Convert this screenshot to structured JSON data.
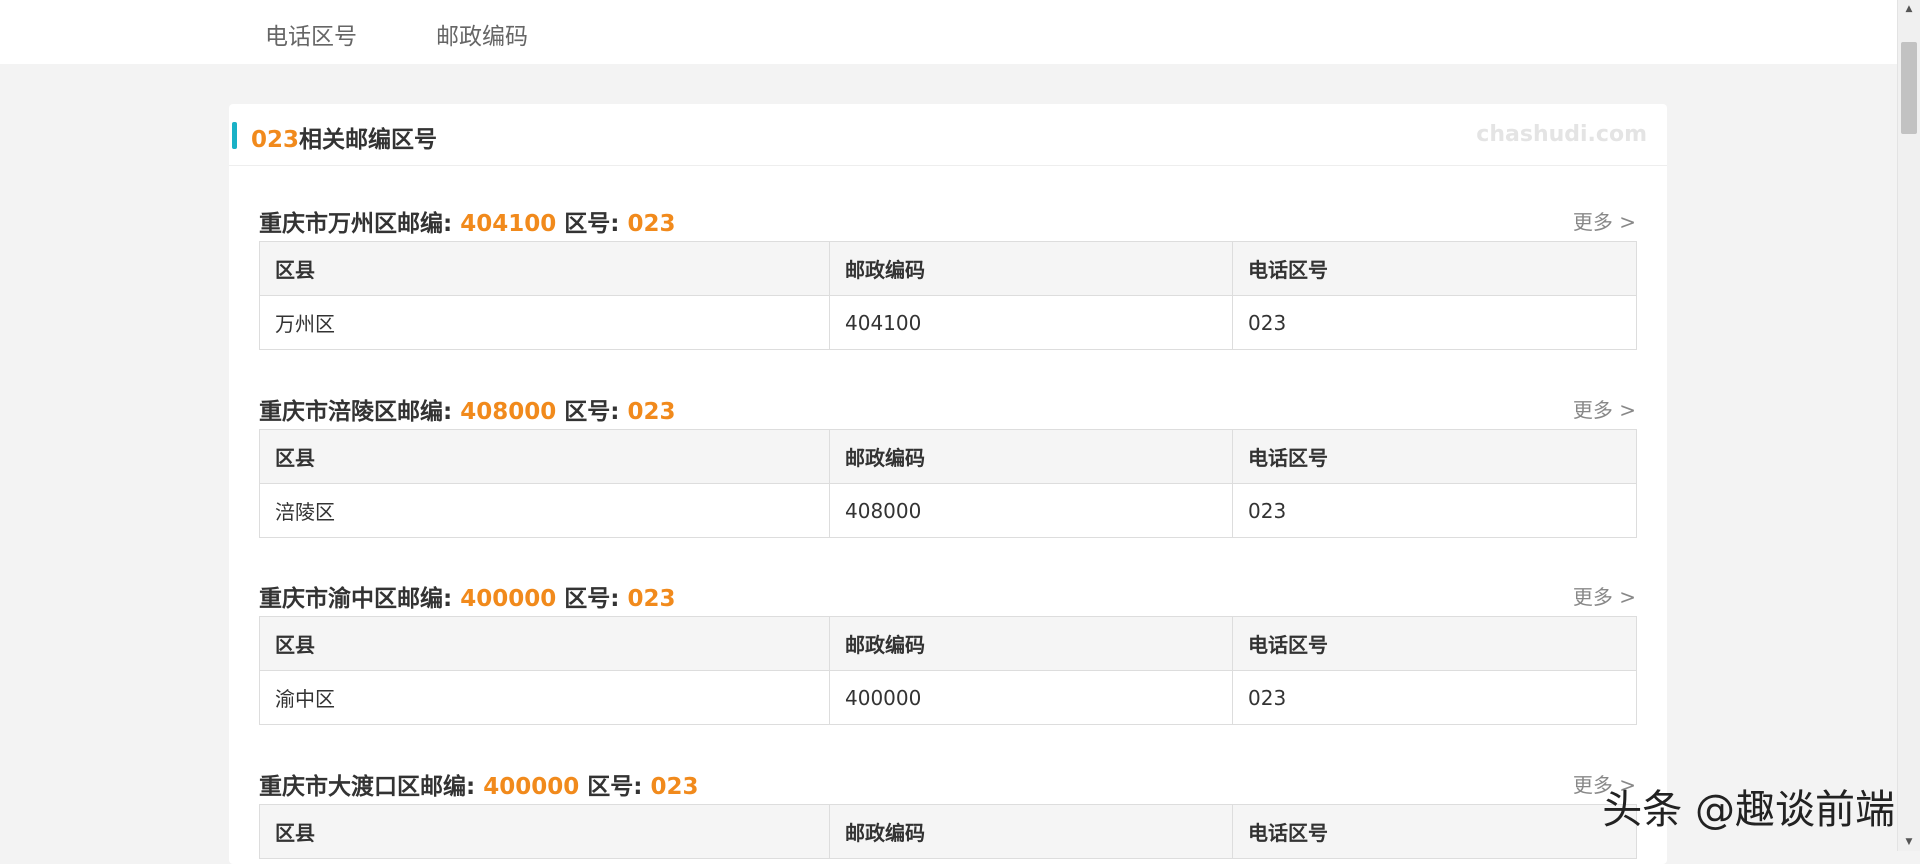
{
  "nav": {
    "items": [
      {
        "label": "电话区号"
      },
      {
        "label": "邮政编码"
      }
    ]
  },
  "card": {
    "title_code": "023",
    "title_text": "相关邮编区号",
    "watermark": "chashudi.com"
  },
  "sections": [
    {
      "city_label": "重庆市万州区邮编",
      "postcode": "404100",
      "area_label": "区号",
      "area_code": "023",
      "more": "更多 >",
      "headers": [
        "区县",
        "邮政编码",
        "电话区号"
      ],
      "row": [
        "万州区",
        "404100",
        "023"
      ]
    },
    {
      "city_label": "重庆市涪陵区邮编",
      "postcode": "408000",
      "area_label": "区号",
      "area_code": "023",
      "more": "更多 >",
      "headers": [
        "区县",
        "邮政编码",
        "电话区号"
      ],
      "row": [
        "涪陵区",
        "408000",
        "023"
      ]
    },
    {
      "city_label": "重庆市渝中区邮编",
      "postcode": "400000",
      "area_label": "区号",
      "area_code": "023",
      "more": "更多 >",
      "headers": [
        "区县",
        "邮政编码",
        "电话区号"
      ],
      "row": [
        "渝中区",
        "400000",
        "023"
      ]
    },
    {
      "city_label": "重庆市大渡口区邮编",
      "postcode": "400000",
      "area_label": "区号",
      "area_code": "023",
      "more": "更多 >",
      "headers": [
        "区县",
        "邮政编码",
        "电话区号"
      ],
      "row": [
        "",
        "",
        ""
      ]
    }
  ],
  "overlay": {
    "brand": "头条 @趣谈前端"
  },
  "colors": {
    "accent": "#1ab1c6",
    "highlight": "#f18a1c"
  }
}
